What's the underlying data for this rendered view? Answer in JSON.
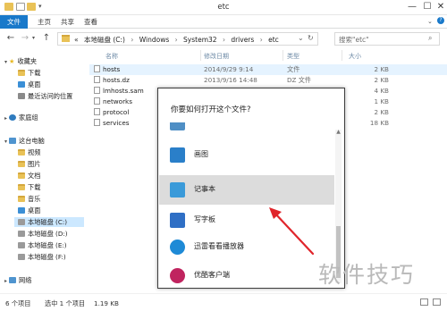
{
  "window": {
    "title": "etc",
    "minimize": "—",
    "maximize": "☐",
    "close": "✕"
  },
  "ribbon": {
    "tabs": [
      "文件",
      "主页",
      "共享",
      "查看"
    ]
  },
  "address": {
    "back": "←",
    "forward": "→",
    "up": "↑",
    "path_segments": [
      "«",
      "本地磁盘 (C:)",
      "›",
      "Windows",
      "›",
      "System32",
      "›",
      "drivers",
      "›",
      "etc"
    ],
    "refresh": "↻",
    "dropdown": "⌄"
  },
  "search": {
    "placeholder": "搜索\"etc\""
  },
  "navpane": {
    "favorites": "收藏夹",
    "favorites_items": [
      "下载",
      "桌面",
      "最近访问的位置"
    ],
    "homegroup": "家庭组",
    "thispc": "这台电脑",
    "thispc_items": [
      "视频",
      "图片",
      "文档",
      "下载",
      "音乐",
      "桌面",
      "本地磁盘 (C:)",
      "本地磁盘 (D:)",
      "本地磁盘 (E:)",
      "本地磁盘 (F:)"
    ],
    "network": "网络"
  },
  "filelist": {
    "headers": [
      "名称",
      "修改日期",
      "类型",
      "大小"
    ],
    "rows": [
      {
        "name": "hosts",
        "date": "2014/9/29 9:14",
        "type": "文件",
        "size": "2 KB"
      },
      {
        "name": "hosts.dz",
        "date": "2013/9/16 14:48",
        "type": "DZ 文件",
        "size": "2 KB"
      },
      {
        "name": "lmhosts.sam",
        "date": "",
        "type": "",
        "size": "4 KB"
      },
      {
        "name": "networks",
        "date": "",
        "type": "",
        "size": "1 KB"
      },
      {
        "name": "protocol",
        "date": "",
        "type": "",
        "size": "2 KB"
      },
      {
        "name": "services",
        "date": "",
        "type": "",
        "size": "18 KB"
      }
    ]
  },
  "status": {
    "item_count": "6 个项目",
    "selected": "选中 1 个项目",
    "size": "1.19 KB"
  },
  "dialog": {
    "title": "你要如何打开这个文件?",
    "apps": [
      {
        "label": "画图",
        "icon": "paint-icon",
        "color": "#2a7fc9"
      },
      {
        "label": "记事本",
        "icon": "notepad-icon",
        "color": "#3a9ad9"
      },
      {
        "label": "写字板",
        "icon": "wordpad-icon",
        "color": "#2f6fc5"
      },
      {
        "label": "迅雷看看播放器",
        "icon": "xunlei-player-icon",
        "color": "#1e8ad6"
      },
      {
        "label": "优酷客户端",
        "icon": "youku-icon",
        "color": "#c0245f"
      }
    ]
  },
  "watermark": "软件技巧",
  "colors": {
    "accent": "#1979ca",
    "selection": "#dcdcdc",
    "annotation": "#e0252b"
  }
}
